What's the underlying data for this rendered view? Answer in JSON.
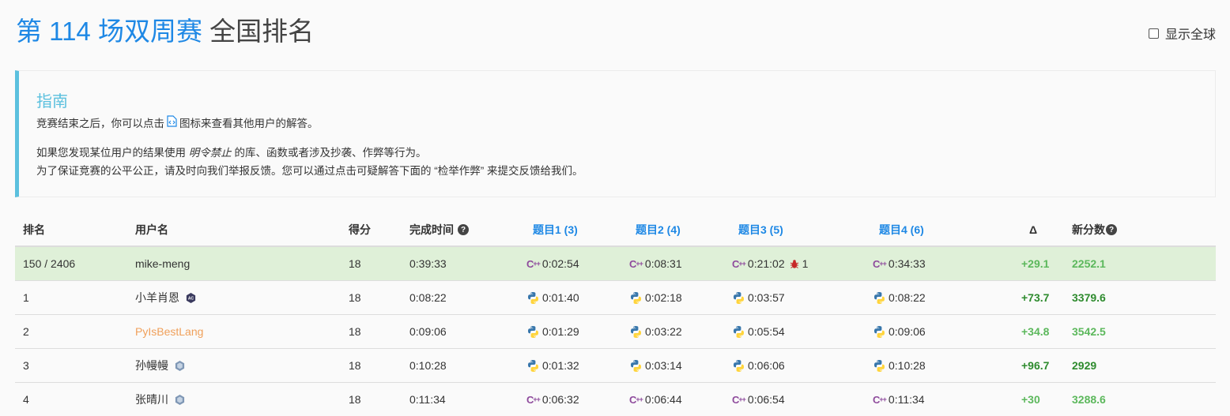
{
  "header": {
    "title_highlight": "第 114 场双周赛",
    "title_rest": "全国排名",
    "global_toggle_label": "显示全球"
  },
  "guide": {
    "title": "指南",
    "line1_before": "竞赛结束之后，你可以点击",
    "line1_after": "图标来查看其他用户的解答。",
    "line2_before": "如果您发现某位用户的结果使用",
    "line2_italic": "明令禁止",
    "line2_after": "的库、函数或者涉及抄袭、作弊等行为。",
    "line3": "为了保证竞赛的公平公正，请及时向我们举报反馈。您可以通过点击可疑解答下面的 “检举作弊” 来提交反馈给我们。"
  },
  "table": {
    "headers": {
      "rank": "排名",
      "user": "用户名",
      "score": "得分",
      "time": "完成时间",
      "q1": "题目1 (3)",
      "q2": "题目2 (4)",
      "q3": "题目3 (5)",
      "q4": "题目4 (6)",
      "delta": "Δ",
      "new_score": "新分数"
    },
    "rows": [
      {
        "rank": "150 / 2406",
        "user": "mike-meng",
        "score": "18",
        "time": "0:39:33",
        "q1": "0:02:54",
        "q2": "0:08:31",
        "q3": "0:21:02",
        "q3_bugs": "1",
        "q4": "0:34:33",
        "delta": "+29.1",
        "new_score": "2252.1",
        "lang": "cpp"
      },
      {
        "rank": "1",
        "user": "小羊肖恩",
        "score": "18",
        "time": "0:08:22",
        "q1": "0:01:40",
        "q2": "0:02:18",
        "q3": "0:03:57",
        "q4": "0:08:22",
        "delta": "+73.7",
        "new_score": "3379.6",
        "lang": "python"
      },
      {
        "rank": "2",
        "user": "PyIsBestLang",
        "score": "18",
        "time": "0:09:06",
        "q1": "0:01:29",
        "q2": "0:03:22",
        "q3": "0:05:54",
        "q4": "0:09:06",
        "delta": "+34.8",
        "new_score": "3542.5",
        "lang": "python"
      },
      {
        "rank": "3",
        "user": "孙幔幔",
        "score": "18",
        "time": "0:10:28",
        "q1": "0:01:32",
        "q2": "0:03:14",
        "q3": "0:06:06",
        "q4": "0:10:28",
        "delta": "+96.7",
        "new_score": "2929",
        "lang": "python"
      },
      {
        "rank": "4",
        "user": "张晴川",
        "score": "18",
        "time": "0:11:34",
        "q1": "0:06:32",
        "q2": "0:06:44",
        "q3": "0:06:54",
        "q4": "0:11:34",
        "delta": "+30",
        "new_score": "3288.6",
        "lang": "cpp"
      }
    ]
  },
  "icons": {
    "cpp_label": "C++",
    "cpp_color": "#8e4a9c",
    "python_blue": "#3776ab",
    "python_yellow": "#ffd43b",
    "delta_light": "#5cb85c",
    "delta_dark": "#2e8b2e",
    "guide_accent": "#5bc0de",
    "title_accent": "#1e88e5"
  }
}
